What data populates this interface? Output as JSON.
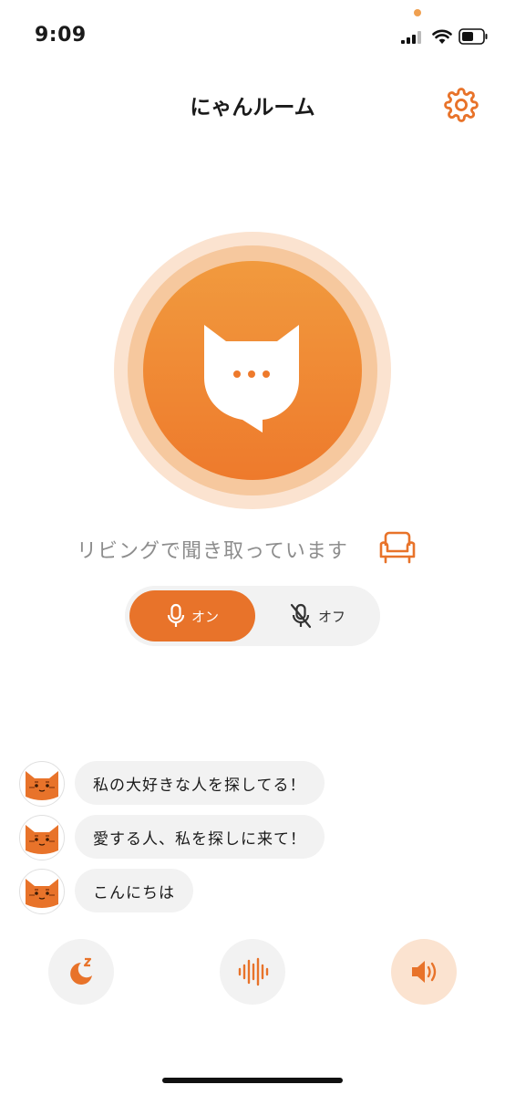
{
  "status": {
    "time": "9:09"
  },
  "header": {
    "title": "にゃんルーム"
  },
  "listening": {
    "text": "リビングで聞き取っています"
  },
  "toggle": {
    "on_label": "オン",
    "off_label": "オフ",
    "selected": "オン"
  },
  "messages": [
    {
      "text": "私の大好きな人を探してる！"
    },
    {
      "text": "愛する人、私を探しに来て！"
    },
    {
      "text": "こんにちは"
    }
  ],
  "controls": [
    {
      "icon": "sleep-moon-icon"
    },
    {
      "icon": "soundwave-icon"
    },
    {
      "icon": "speaker-icon",
      "active": true
    }
  ],
  "colors": {
    "accent": "#e8732a",
    "accent_light": "#fbe3d0",
    "bubble": "#f2f2f2"
  }
}
